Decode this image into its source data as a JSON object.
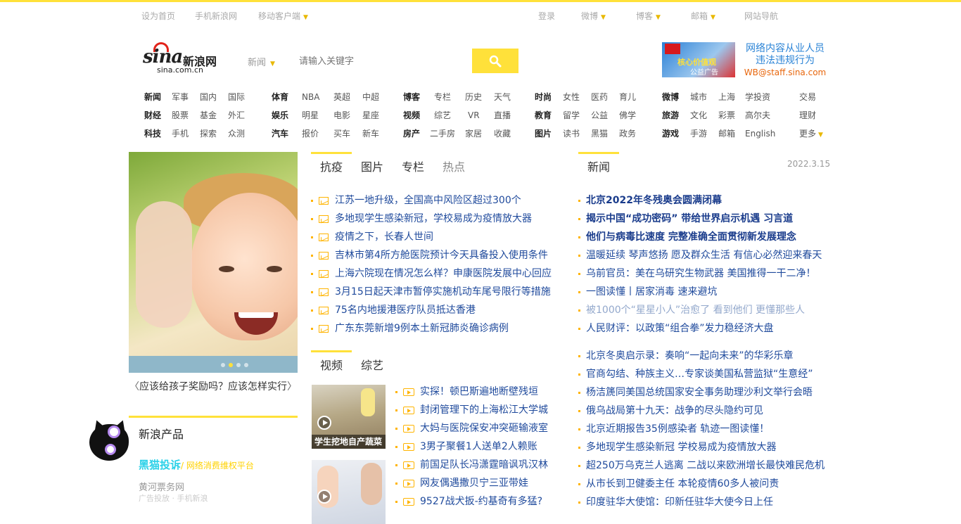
{
  "topbar": {
    "items": [
      "设为首页",
      "手机新浪网",
      "移动客户端",
      "登录",
      "微博",
      "博客",
      "邮箱",
      "网站导航"
    ]
  },
  "logo": {
    "brand": "sina",
    "cn": "新浪网",
    "domain": "sina.com.cn"
  },
  "search": {
    "scope": "新闻",
    "placeholder": "请输入关键字"
  },
  "ad": {
    "banner_text": "核心价值观",
    "banner_sub": "公益广告",
    "line1": "网络内容从业人员",
    "line2": "违法违规行为",
    "email": "WB@staff.sina.com"
  },
  "nav": {
    "g1": [
      [
        "新闻",
        "军事",
        "国内",
        "国际"
      ],
      [
        "财经",
        "股票",
        "基金",
        "外汇"
      ],
      [
        "科技",
        "手机",
        "探索",
        "众测"
      ]
    ],
    "g2": [
      [
        "体育",
        "NBA",
        "英超",
        "中超"
      ],
      [
        "娱乐",
        "明星",
        "电影",
        "星座"
      ],
      [
        "汽车",
        "报价",
        "买车",
        "新车"
      ]
    ],
    "g3": [
      [
        "博客",
        "专栏",
        "历史",
        "天气"
      ],
      [
        "视频",
        "综艺",
        "VR",
        "直播"
      ],
      [
        "房产",
        "二手房",
        "家居",
        "收藏"
      ]
    ],
    "g4": [
      [
        "时尚",
        "女性",
        "医药",
        "育儿"
      ],
      [
        "教育",
        "留学",
        "公益",
        "佛学"
      ],
      [
        "图片",
        "读书",
        "黑猫",
        "政务"
      ]
    ],
    "g5": [
      [
        "微博",
        "城市",
        "上海",
        "学投资"
      ],
      [
        "旅游",
        "文化",
        "彩票",
        "高尔夫"
      ],
      [
        "游戏",
        "手游",
        "邮箱",
        "English"
      ]
    ],
    "g6": [
      "交易",
      "理财",
      "更多"
    ]
  },
  "feature": {
    "caption": "应该给孩子奖励吗？应该怎样实行"
  },
  "products": {
    "title": "新浪产品",
    "heimao": "黑猫投诉",
    "heimao_sub": "/ 网络消费维权平台",
    "item2": "黄河票务网",
    "item3": "广告投放 · 手机新浪"
  },
  "tabs1": [
    "抗疫",
    "图片",
    "专栏",
    "热点"
  ],
  "list1": [
    "江苏一地升级，全国高中风险区超过300个",
    "多地现学生感染新冠，学校易成为疫情放大器",
    "疫情之下，长春人世间",
    "吉林市第4所方舱医院预计今天具备投入使用条件",
    "上海六院现在情况怎么样？申康医院发展中心回应",
    "3月15日起天津市暂停实施机动车尾号限行等措施",
    "75名内地援港医疗队员抵达香港",
    "广东东莞新增9例本土新冠肺炎确诊病例"
  ],
  "tabs2": [
    "视频",
    "综艺"
  ],
  "video_caption": "学生挖地自产蔬菜",
  "vlist": [
    "实探！顿巴斯遍地断壁残垣",
    "封闭管理下的上海松江大学城",
    "大妈与医院保安冲突砸输液室",
    "3男子聚餐1人送单2人赖账",
    "前国足队长冯潇霆暗讽巩汉林",
    "网友偶遇撒贝宁三亚带娃",
    "9527战犬扳-约基奇有多猛?"
  ],
  "news": {
    "tab": "新闻",
    "date": "2022.3.15",
    "top": [
      "北京2022年冬残奥会圆满闭幕",
      "揭示中国“成功密码” 带给世界启示机遇 习言道",
      "他们与病毒比速度 完整准确全面贯彻新发展理念"
    ],
    "list": [
      "温暖延续 琴声悠扬 愿及群众生活 有信心必然迎来春天",
      "乌前官员：美在乌研究生物武器 美国推得一干二净！",
      "一图读懂丨居家消毒 速来避坑",
      "被1000个“星星小人”治愈了 看到他们 更懂那些人",
      "人民财评：以政策“组合拳”发力稳经济大盘"
    ],
    "list2": [
      "北京冬奥启示录：奏响“一起向未来”的华彩乐章",
      "官商勾结、种族主义…专家谈美国私营监狱“生意经”",
      "杨洁篪同美国总统国家安全事务助理沙利文举行会晤",
      "俄乌战局第十九天：战争的尽头隐约可见",
      "北京近期报告35例感染者 轨迹一图读懂！",
      "多地现学生感染新冠 学校易成为疫情放大器",
      "超250万乌克兰人逃离 二战以来欧洲增长最快难民危机",
      "从市长到卫健委主任 本轮疫情60多人被问责",
      "印度驻华大使馆：印新任驻华大使今日上任"
    ]
  },
  "colors": {
    "accent": "#ffe13a",
    "link": "#1f4a9c",
    "brand_red": "#e2231a"
  }
}
